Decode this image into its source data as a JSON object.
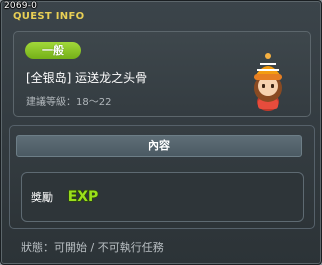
{
  "window": {
    "id_label": "2069-0",
    "title": "QUEST INFO"
  },
  "quest": {
    "category_badge": "一般",
    "name": "[全银岛] 运送龙之头骨",
    "level_label": "建議等級：18～22",
    "npc_icon": "npc-portrait-icon"
  },
  "content": {
    "tab_label": "內容",
    "reward_label": "獎勵",
    "reward_icon": "exp-icon",
    "reward_icon_text": "EXP"
  },
  "status": {
    "text": "狀態：可開始 / 不可執行任務"
  },
  "colors": {
    "title": "#e8cf55",
    "badge": "#8cc628",
    "exp_fill": "#9be01c"
  }
}
